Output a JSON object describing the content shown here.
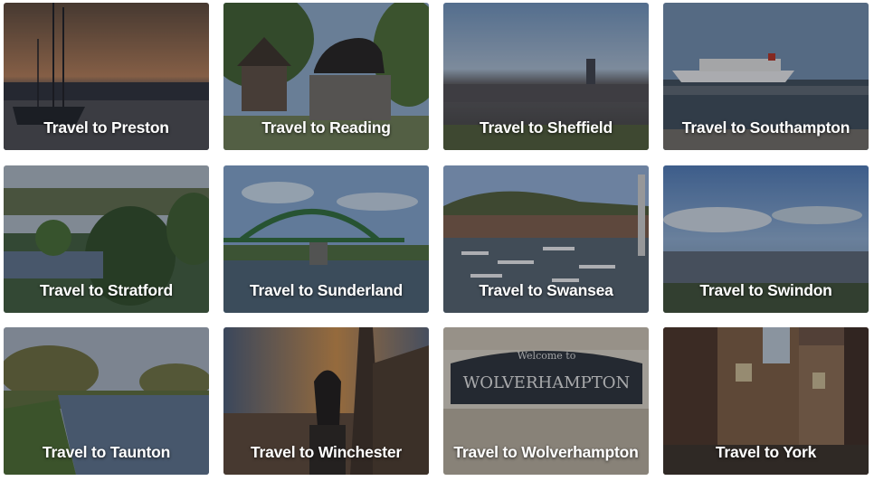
{
  "destinations": [
    {
      "label": "Travel to Preston"
    },
    {
      "label": "Travel to Reading"
    },
    {
      "label": "Travel to Sheffield"
    },
    {
      "label": "Travel to Southampton"
    },
    {
      "label": "Travel to Stratford"
    },
    {
      "label": "Travel to Sunderland"
    },
    {
      "label": "Travel to Swansea"
    },
    {
      "label": "Travel to Swindon"
    },
    {
      "label": "Travel to Taunton"
    },
    {
      "label": "Travel to Winchester"
    },
    {
      "label": "Travel to Wolverhampton"
    },
    {
      "label": "Travel to York"
    }
  ],
  "signs": {
    "wolverhampton_welcome": "Welcome to",
    "wolverhampton_name": "WOLVERHAMPTON"
  }
}
